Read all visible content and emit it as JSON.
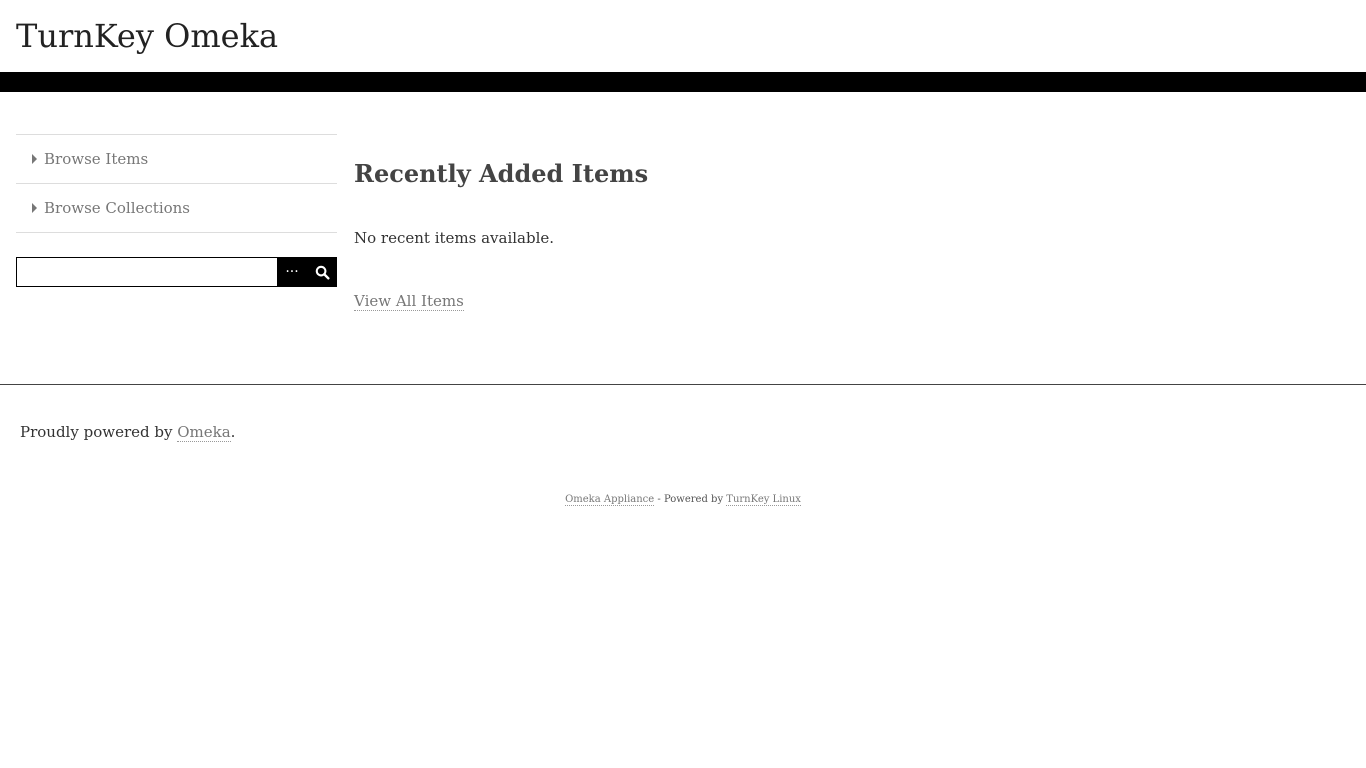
{
  "header": {
    "site_title": "TurnKey Omeka"
  },
  "sidebar": {
    "items": [
      {
        "label": "Browse Items",
        "icon": "caret-right-icon"
      },
      {
        "label": "Browse Collections",
        "icon": "caret-right-icon"
      }
    ],
    "search": {
      "value": "",
      "placeholder": "",
      "advanced_label": "···",
      "submit_icon": "search-icon"
    }
  },
  "main": {
    "heading": "Recently Added Items",
    "empty_message": "No recent items available.",
    "view_all_label": "View All Items"
  },
  "footer": {
    "powered_prefix": "Proudly powered by ",
    "powered_link": "Omeka",
    "powered_suffix": ".",
    "appliance_link": "Omeka Appliance",
    "appliance_middle": " - Powered by ",
    "turnkey_link": "TurnKey Linux"
  }
}
